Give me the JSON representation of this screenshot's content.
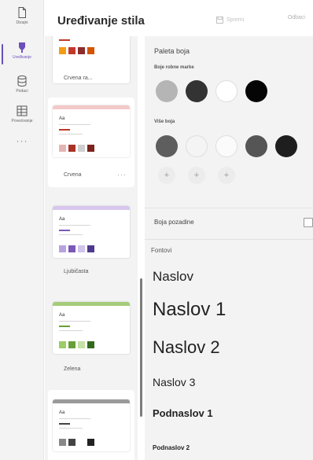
{
  "rail": {
    "items": [
      {
        "label": "Dizajni",
        "icon": "document-icon"
      },
      {
        "label": "Uređivanje",
        "icon": "brush-icon"
      },
      {
        "label": "Podaci",
        "icon": "database-icon"
      },
      {
        "label": "Povezivanje",
        "icon": "table-icon"
      }
    ],
    "more": "···"
  },
  "header": {
    "title": "Uređivanje stila",
    "save_label": "Spremi",
    "cancel_label": "Odbaci"
  },
  "themes": [
    {
      "name": "Crvena ra...",
      "accent": "#c0392b",
      "swatches": [
        "#f39c12",
        "#c0392b",
        "#8e2b2b",
        "#d35400"
      ]
    },
    {
      "name": "Crvena",
      "accent": "#c0392b",
      "more": "···",
      "swatches": [
        "#e5b5b5",
        "#a93226",
        "#cfcfcf",
        "#7b241c"
      ]
    },
    {
      "name": "Ljubičasta",
      "accent": "#8e5fc8",
      "swatches": [
        "#b8a3dd",
        "#7b59b8",
        "#d1c4ea",
        "#4f3b8c"
      ]
    },
    {
      "name": "Zelena",
      "accent": "#7cb342",
      "swatches": [
        "#9ccc65",
        "#689f38",
        "#c5e1a5",
        "#33691e"
      ]
    },
    {
      "name": "",
      "accent": "#555555",
      "swatches": [
        "#888888",
        "#444444",
        "#bbbbbb",
        "#222222"
      ]
    }
  ],
  "palette": {
    "title": "Paleta boja",
    "brand_label": "Boje robne marke",
    "brand_colors": [
      "#b5b5b5",
      "#333333",
      "#ffffff",
      "#050505"
    ],
    "more_label": "Više boja",
    "more_colors": [
      "#5e5e5e",
      "#f4f4f4",
      "#fbfbfb",
      "#555555",
      "#1e1e1e"
    ],
    "add_symbol": "+"
  },
  "background": {
    "label": "Boja pozadine",
    "checked": false
  },
  "fonts": {
    "title": "Fontovi",
    "items": [
      "Naslov",
      "Naslov 1",
      "Naslov 2",
      "Naslov 3",
      "Podnaslov 1",
      "Podnaslov 2"
    ]
  }
}
